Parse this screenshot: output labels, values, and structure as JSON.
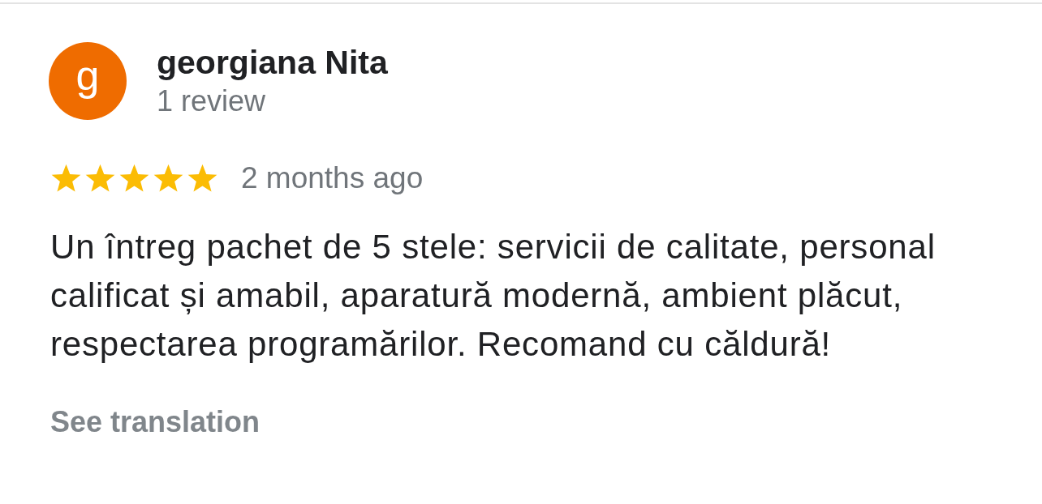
{
  "reviewer": {
    "avatar": {
      "letter": "g",
      "color": "#ef6c00"
    },
    "name": "georgiana Nita",
    "review_count": "1 review"
  },
  "review": {
    "stars": 5,
    "time": "2 months ago",
    "text": "Un întreg pachet de 5 stele: servicii de calitate, personal calificat și amabil, aparatură modernă, ambient plăcut, respectarea programărilor. Recomand cu căldură!",
    "translation_link": "See translation"
  }
}
